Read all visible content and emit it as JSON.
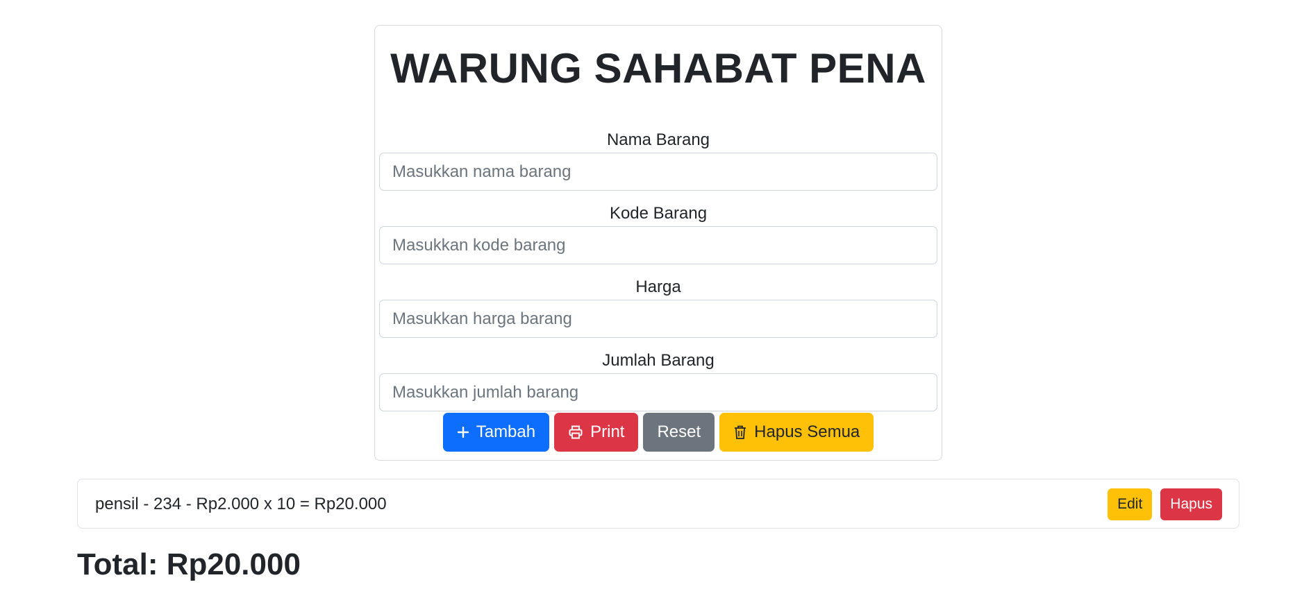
{
  "title": "WARUNG SAHABAT PENA",
  "fields": [
    {
      "label": "Nama Barang",
      "placeholder": "Masukkan nama barang",
      "value": ""
    },
    {
      "label": "Kode Barang",
      "placeholder": "Masukkan kode barang",
      "value": ""
    },
    {
      "label": "Harga",
      "placeholder": "Masukkan harga barang",
      "value": ""
    },
    {
      "label": "Jumlah Barang",
      "placeholder": "Masukkan jumlah barang",
      "value": ""
    }
  ],
  "buttons": {
    "add": {
      "label": "Tambah",
      "icon": "plus-icon",
      "color": "#0d6efd"
    },
    "print": {
      "label": "Print",
      "icon": "printer-icon",
      "color": "#dc3545"
    },
    "reset": {
      "label": "Reset",
      "color": "#6c757d"
    },
    "clear_all": {
      "label": "Hapus Semua",
      "icon": "trash-icon",
      "color": "#ffc107"
    }
  },
  "items": [
    {
      "text": "pensil - 234 - Rp2.000 x 10 = Rp20.000",
      "edit_label": "Edit",
      "delete_label": "Hapus"
    }
  ],
  "total": "Total: Rp20.000"
}
